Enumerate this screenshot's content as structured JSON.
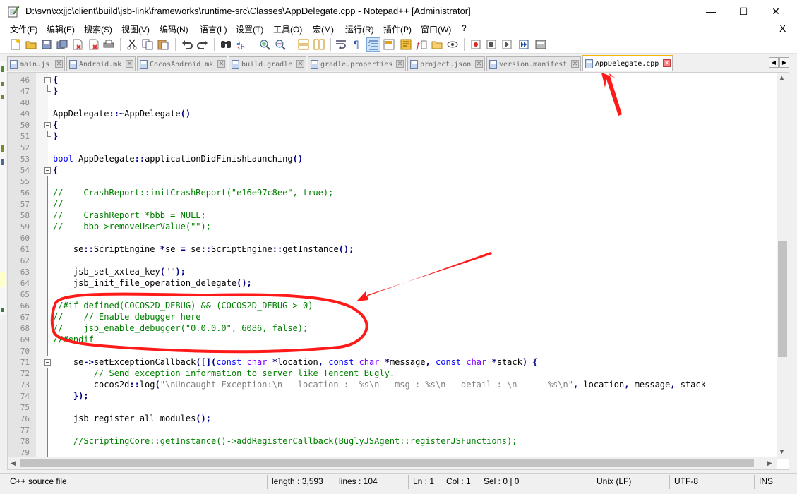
{
  "window": {
    "title": "D:\\svn\\xxjjc\\client\\build\\jsb-link\\frameworks\\runtime-src\\Classes\\AppDelegate.cpp - Notepad++ [Administrator]",
    "minimize": "—",
    "maximize": "☐",
    "close": "✕"
  },
  "menu": {
    "items": [
      "文件(F)",
      "编辑(E)",
      "搜索(S)",
      "视图(V)",
      "编码(N)",
      "语言(L)",
      "设置(T)",
      "工具(O)",
      "宏(M)",
      "运行(R)",
      "插件(P)",
      "窗口(W)",
      "?"
    ],
    "close_doc": "X"
  },
  "toolbar": {
    "icons": [
      "new-file-icon",
      "open-file-icon",
      "save-icon",
      "save-all-icon",
      "close-icon",
      "close-all-icon",
      "print-icon",
      "cut-icon",
      "copy-icon",
      "paste-icon",
      "undo-icon",
      "redo-icon",
      "find-icon",
      "replace-icon",
      "zoom-in-icon",
      "zoom-out-icon",
      "sync-vertical-icon",
      "sync-horizontal-icon",
      "word-wrap-icon",
      "show-all-chars-icon",
      "indent-guide-icon",
      "udl-icon",
      "doc-map-icon",
      "function-list-icon",
      "folder-workspace-icon",
      "monitoring-icon",
      "record-macro-icon",
      "stop-record-icon",
      "play-macro-icon",
      "play-multiple-icon",
      "save-macro-icon"
    ]
  },
  "tabs": [
    {
      "label": "main.js"
    },
    {
      "label": "Android.mk"
    },
    {
      "label": "CocosAndroid.mk"
    },
    {
      "label": "build.gradle"
    },
    {
      "label": "gradle.properties"
    },
    {
      "label": "project.json"
    },
    {
      "label": "version.manifest"
    },
    {
      "label": "AppDelegate.cpp"
    }
  ],
  "editor": {
    "lines": [
      {
        "n": "46",
        "text": "{"
      },
      {
        "n": "47",
        "text": "}"
      },
      {
        "n": "48",
        "text": ""
      },
      {
        "n": "49",
        "text": "AppDelegate::~AppDelegate()"
      },
      {
        "n": "50",
        "text": "{"
      },
      {
        "n": "51",
        "text": "}"
      },
      {
        "n": "52",
        "text": ""
      },
      {
        "n": "53",
        "text": "bool AppDelegate::applicationDidFinishLaunching()"
      },
      {
        "n": "54",
        "text": "{"
      },
      {
        "n": "55",
        "text": ""
      },
      {
        "n": "56",
        "text": "//    CrashReport::initCrashReport(\"e16e97c8ee\", true);"
      },
      {
        "n": "57",
        "text": "//"
      },
      {
        "n": "58",
        "text": "//    CrashReport *bbb = NULL;"
      },
      {
        "n": "59",
        "text": "//    bbb->removeUserValue(\"\");"
      },
      {
        "n": "60",
        "text": ""
      },
      {
        "n": "61",
        "text": "    se::ScriptEngine *se = se::ScriptEngine::getInstance();"
      },
      {
        "n": "62",
        "text": ""
      },
      {
        "n": "63",
        "text": "    jsb_set_xxtea_key(\"\");"
      },
      {
        "n": "64",
        "text": "    jsb_init_file_operation_delegate();"
      },
      {
        "n": "65",
        "text": ""
      },
      {
        "n": "66",
        "text": "//#if defined(COCOS2D_DEBUG) && (COCOS2D_DEBUG > 0)"
      },
      {
        "n": "67",
        "text": "//    // Enable debugger here"
      },
      {
        "n": "68",
        "text": "//    jsb_enable_debugger(\"0.0.0.0\", 6086, false);"
      },
      {
        "n": "69",
        "text": "//#endif"
      },
      {
        "n": "70",
        "text": ""
      },
      {
        "n": "71",
        "text": "    se->setExceptionCallback([](const char *location, const char *message, const char *stack) {"
      },
      {
        "n": "72",
        "text": "        // Send exception information to server like Tencent Bugly."
      },
      {
        "n": "73",
        "text": "        cocos2d::log(\"\\nUncaught Exception:\\n - location :  %s\\n - msg : %s\\n - detail : \\n      %s\\n\", location, message, stack"
      },
      {
        "n": "74",
        "text": "    });"
      },
      {
        "n": "75",
        "text": ""
      },
      {
        "n": "76",
        "text": "    jsb_register_all_modules();"
      },
      {
        "n": "77",
        "text": ""
      },
      {
        "n": "78",
        "text": "    //ScriptingCore::getInstance()->addRegisterCallback(BuglyJSAgent::registerJSFunctions);"
      },
      {
        "n": "79",
        "text": ""
      }
    ]
  },
  "status": {
    "file_type": "C++ source file",
    "length": "length : 3,593",
    "lines": "lines : 104",
    "ln": "Ln : 1",
    "col": "Col : 1",
    "sel": "Sel : 0 | 0",
    "eol": "Unix (LF)",
    "encoding": "UTF-8",
    "mode": "INS"
  },
  "colors": {
    "keyword": "#0000ff",
    "type": "#8000ff",
    "comment": "#008000",
    "string": "#808080",
    "annotation": "#ff1a1a",
    "active_tab_accent": "#f7b500"
  }
}
